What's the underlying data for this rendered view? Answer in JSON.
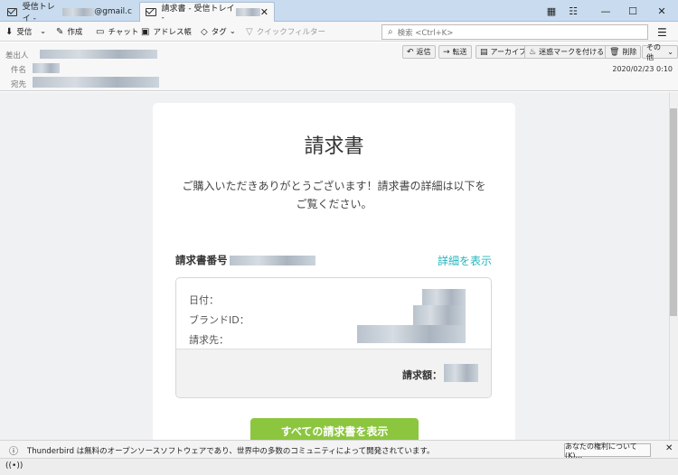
{
  "tabs": [
    {
      "label": "受信トレイ - ",
      "suffix": "@gmail.c"
    },
    {
      "label": "請求書 - 受信トレイ - "
    }
  ],
  "window": {
    "minimize": "—",
    "maximize": "☐",
    "close": "✕",
    "tab_close": "✕"
  },
  "toolbar": {
    "get_mail": "受信",
    "write": "作成",
    "chat": "チャット",
    "address_book": "アドレス帳",
    "tag": "タグ",
    "quick_filter": "クイックフィルター",
    "search_placeholder": "検索 <Ctrl+K>",
    "menu": "☰"
  },
  "header": {
    "from_label": "差出人",
    "subject_label": "件名",
    "to_label": "宛先",
    "reply": "返信",
    "forward": "転送",
    "archive": "アーカイブ",
    "junk": "迷惑マークを付ける",
    "delete": "削除",
    "other": "その他",
    "date": "2020/02/23 0:10"
  },
  "email": {
    "title": "請求書",
    "intro": "ご購入いただきありがとうございます！請求書の詳細は以下をご覧ください。",
    "invoice_no_label": "請求書番号",
    "detail_link": "詳細を表示",
    "date_label": "日付：",
    "brand_id_label": "ブランドID：",
    "bill_to_label": "請求先：",
    "total_label": "請求額：",
    "all_invoices_button": "すべての請求書を表示"
  },
  "status": {
    "text": "Thunderbird は無料のオープンソースソフトウェアであり、世界中の多数のコミュニティによって開発されています。",
    "rights_button": "あなたの権利について(K)..."
  }
}
